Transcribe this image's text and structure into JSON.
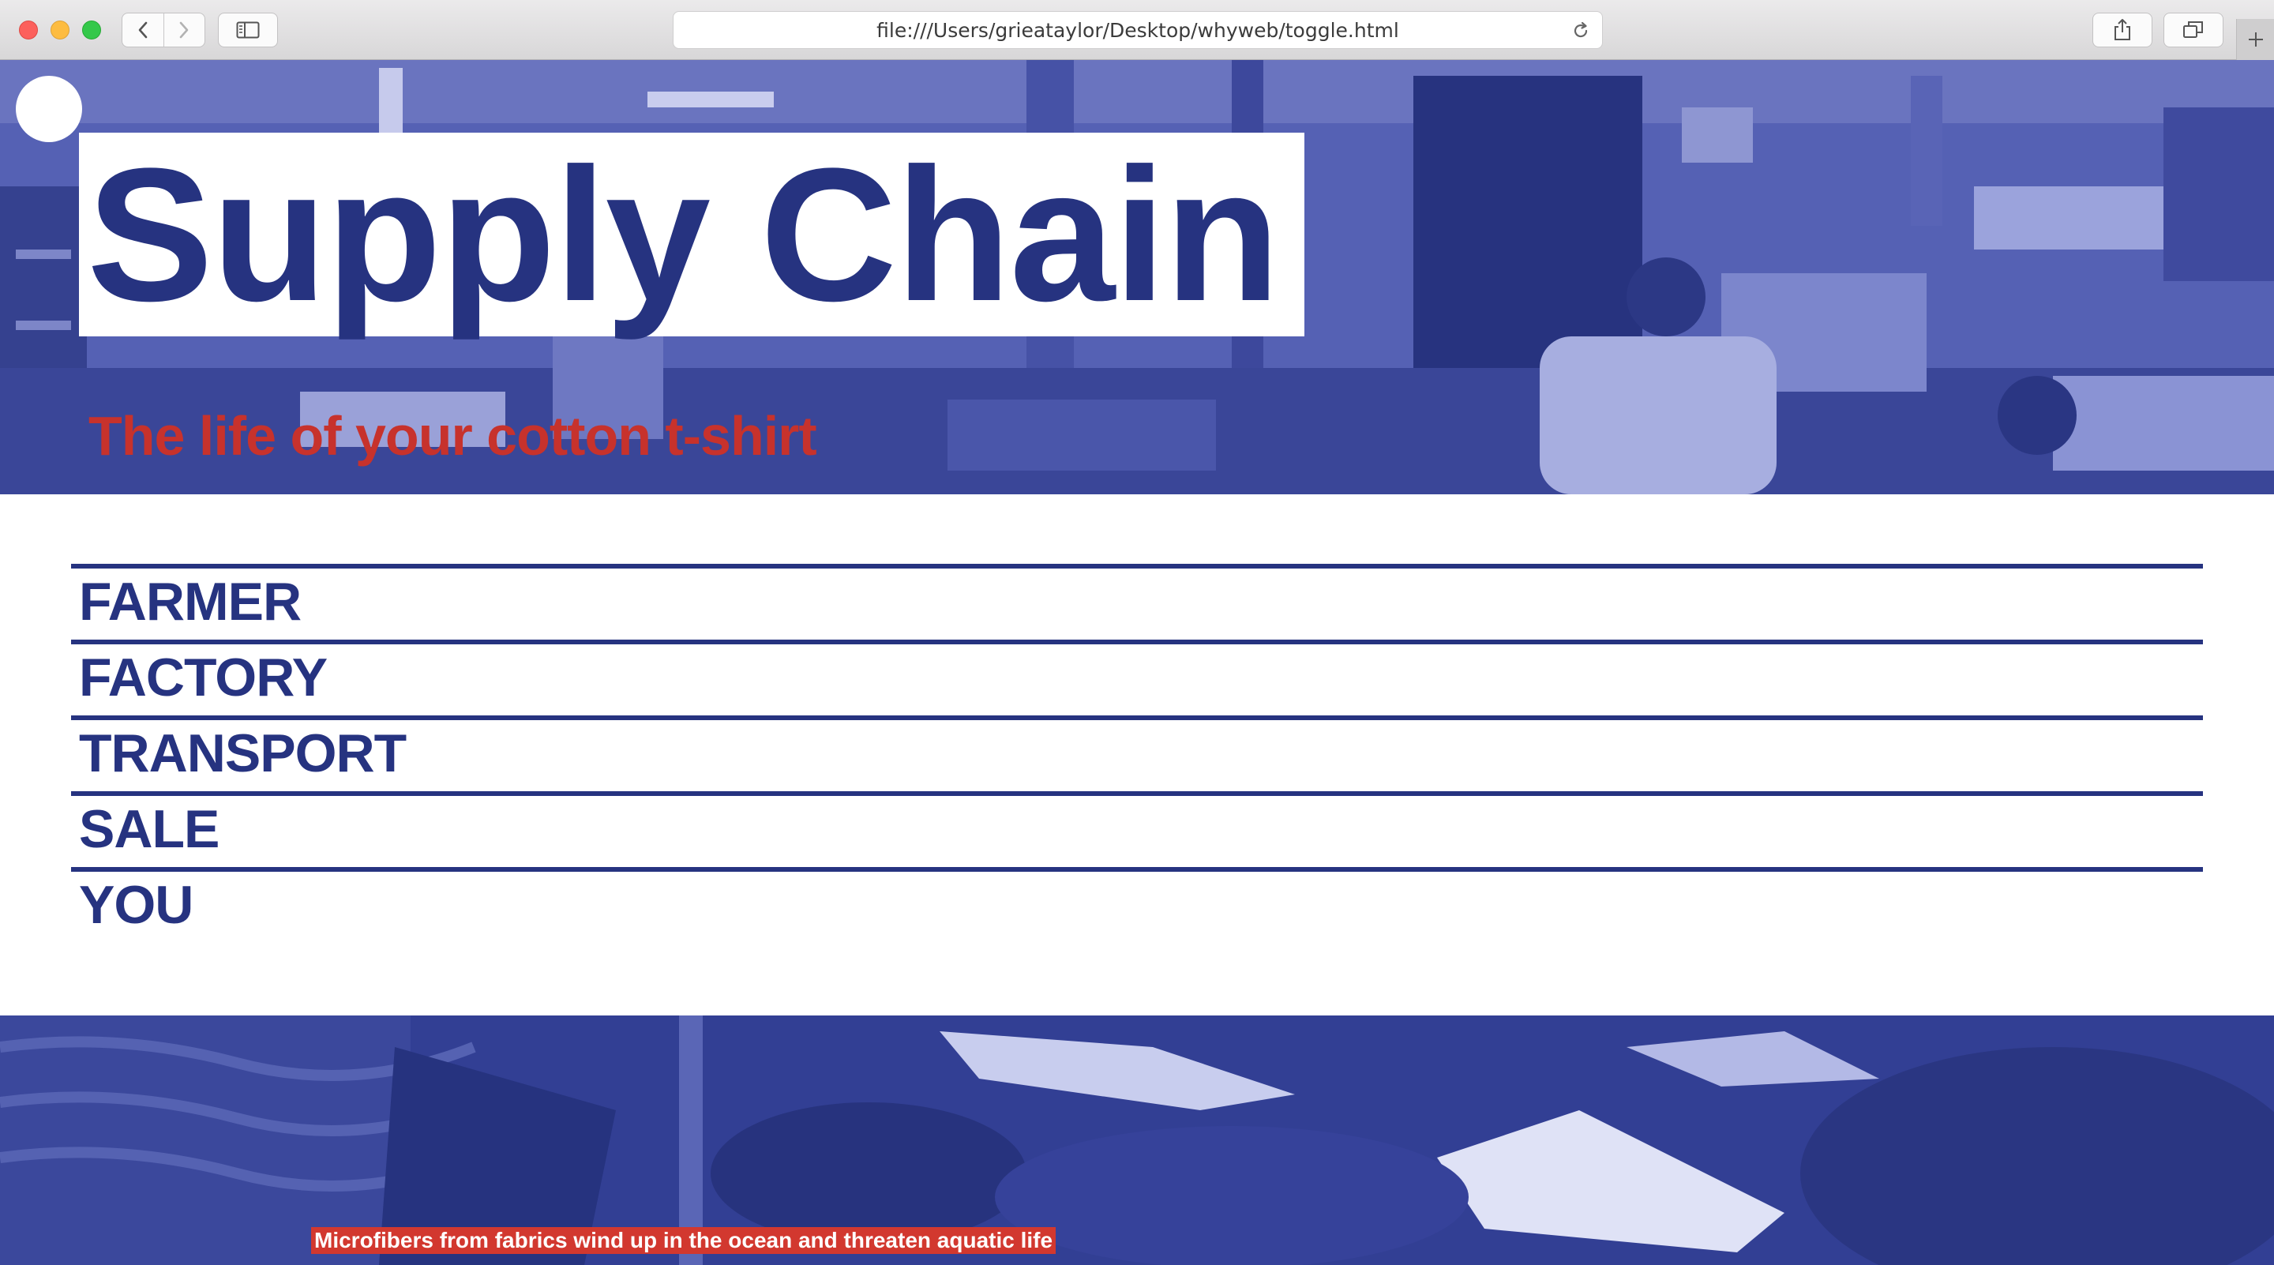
{
  "browser": {
    "url": "file:///Users/grieataylor/Desktop/whyweb/toggle.html",
    "icons": [
      "back-chevron-icon",
      "forward-chevron-icon",
      "sidebar-icon",
      "reload-icon",
      "share-icon",
      "tabs-icon",
      "plus-icon"
    ]
  },
  "hero": {
    "title": "Supply Chain",
    "subtitle": "The life of your cotton t-shirt"
  },
  "menu": {
    "items": [
      {
        "label": "FARMER"
      },
      {
        "label": "FACTORY"
      },
      {
        "label": "TRANSPORT"
      },
      {
        "label": "SALE"
      },
      {
        "label": "YOU"
      }
    ]
  },
  "footer": {
    "caption": "Microfibers from fabrics wind up in the ocean and threaten aquatic life"
  },
  "colors": {
    "brand_blue": "#263380",
    "accent_red": "#c7322c",
    "caption_bg": "#d2382f"
  }
}
